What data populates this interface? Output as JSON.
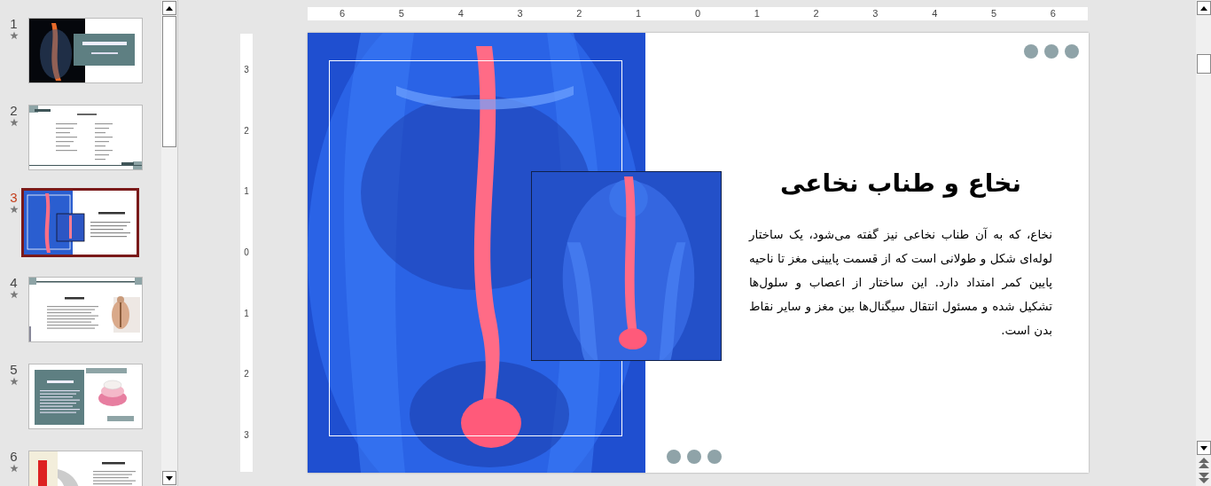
{
  "slides_panel": {
    "slides": [
      {
        "number": "1",
        "selected": false,
        "kind": "title"
      },
      {
        "number": "2",
        "selected": false,
        "kind": "list"
      },
      {
        "number": "3",
        "selected": true
      },
      {
        "number": "4",
        "selected": false,
        "kind": "figure"
      },
      {
        "number": "5",
        "selected": false,
        "kind": "diagram"
      },
      {
        "number": "6",
        "selected": false,
        "kind": "xray"
      }
    ]
  },
  "horizontal_ruler": [
    "6",
    "5",
    "4",
    "3",
    "2",
    "1",
    "0",
    "1",
    "2",
    "3",
    "4",
    "5",
    "6"
  ],
  "vertical_ruler": [
    "3",
    "2",
    "1",
    "0",
    "1",
    "2",
    "3"
  ],
  "slide": {
    "title": "نخاع و طناب نخاعی",
    "body": "نخاع، که به آن طناب نخاعی نیز گفته می‌شود، یک ساختار لوله‌ای شکل و طولانی است که از قسمت پایینی مغز تا ناحیه پایین کمر امتداد دارد. این ساختار از اعصاب و سلول‌ها تشکیل شده و مسئول انتقال سیگنال‌ها بین مغز و سایر نقاط بدن است."
  }
}
